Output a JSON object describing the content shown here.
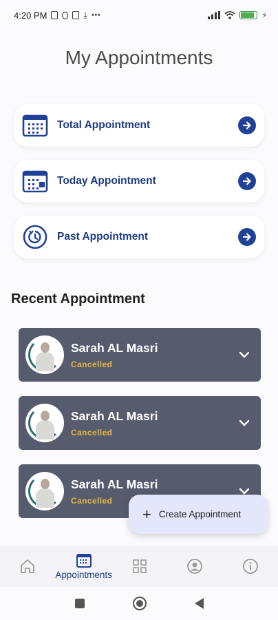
{
  "status_bar": {
    "time": "4:20 PM",
    "more": "⋯"
  },
  "page": {
    "title": "My Appointments"
  },
  "summary_cards": [
    {
      "label": "Total Appointment",
      "icon": "calendar-grid-icon"
    },
    {
      "label": "Today Appointment",
      "icon": "calendar-today-icon"
    },
    {
      "label": "Past Appointment",
      "icon": "history-icon"
    }
  ],
  "recent": {
    "title": "Recent Appointment",
    "items": [
      {
        "name": "Sarah AL Masri",
        "status": "Cancelled"
      },
      {
        "name": "Sarah AL Masri",
        "status": "Cancelled"
      },
      {
        "name": "Sarah AL Masri",
        "status": "Cancelled"
      }
    ]
  },
  "fab": {
    "plus": "+",
    "label": "Create Appointment"
  },
  "bottom_nav": {
    "active_label": "Appointments",
    "items": [
      "home-icon",
      "appointments-icon",
      "grid-icon",
      "profile-icon",
      "info-icon"
    ]
  },
  "colors": {
    "primary": "#1f4196",
    "card_dark": "#575b6e",
    "status_cancelled": "#e8b83a",
    "fab_bg": "#e4e6fb"
  }
}
